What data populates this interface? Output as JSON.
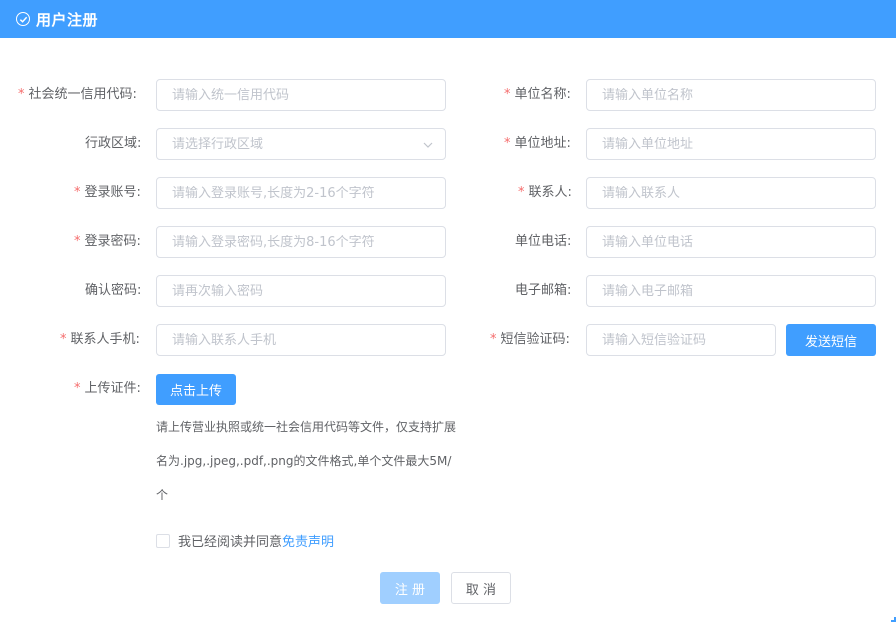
{
  "window": {
    "title": "用户注册"
  },
  "form": {
    "credit_code": {
      "label": "社会统一信用代码:",
      "placeholder": "请输入统一信用代码"
    },
    "unit_name": {
      "label": "单位名称:",
      "placeholder": "请输入单位名称"
    },
    "region": {
      "label": "行政区域:",
      "placeholder": "请选择行政区域"
    },
    "unit_address": {
      "label": "单位地址:",
      "placeholder": "请输入单位地址"
    },
    "account": {
      "label": "登录账号:",
      "placeholder": "请输入登录账号,长度为2-16个字符"
    },
    "contact": {
      "label": "联系人:",
      "placeholder": "请输入联系人"
    },
    "password": {
      "label": "登录密码:",
      "placeholder": "请输入登录密码,长度为8-16个字符"
    },
    "unit_phone": {
      "label": "单位电话:",
      "placeholder": "请输入单位电话"
    },
    "confirm_password": {
      "label": "确认密码:",
      "placeholder": "请再次输入密码"
    },
    "email": {
      "label": "电子邮箱:",
      "placeholder": "请输入电子邮箱"
    },
    "contact_mobile": {
      "label": "联系人手机:",
      "placeholder": "请输入联系人手机"
    },
    "sms_code": {
      "label": "短信验证码:",
      "placeholder": "请输入短信验证码",
      "send_label": "发送短信"
    },
    "upload": {
      "label": "上传证件:",
      "button_label": "点击上传",
      "hint_lines": [
        "请上传营业执照或统一社会信用代码等文件，仅支持扩展",
        "名为.jpg,.jpeg,.pdf,.png的文件格式,单个文件最大5M/",
        "个"
      ]
    },
    "agreement": {
      "text": "我已经阅读并同意",
      "link": "免责声明"
    },
    "submit_label": "注 册",
    "cancel_label": "取 消",
    "required_mark": "*"
  },
  "colors": {
    "primary": "#409eff",
    "required": "#f56c6c",
    "disabled": "#a0cfff"
  }
}
